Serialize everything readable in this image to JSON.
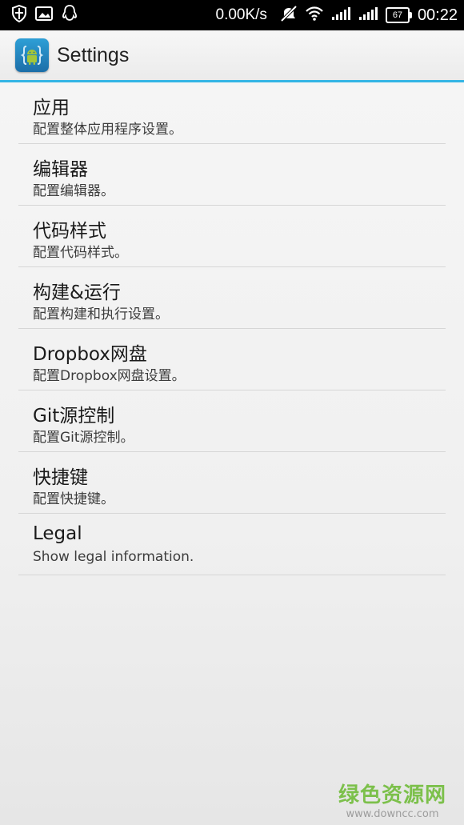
{
  "status_bar": {
    "net_speed": "0.00K/s",
    "battery": "67",
    "time": "00:22",
    "icons": [
      "shield-icon",
      "image-icon",
      "qq-icon",
      "mute-icon",
      "wifi-icon",
      "signal-icon",
      "signal-icon"
    ]
  },
  "action_bar": {
    "title": "Settings",
    "accent_color": "#33b5e5"
  },
  "settings": {
    "items": [
      {
        "title": "应用",
        "subtitle": "配置整体应用程序设置。"
      },
      {
        "title": "编辑器",
        "subtitle": "配置编辑器。"
      },
      {
        "title": "代码样式",
        "subtitle": "配置代码样式。"
      },
      {
        "title": "构建&运行",
        "subtitle": "配置构建和执行设置。"
      },
      {
        "title": "Dropbox网盘",
        "subtitle": "配置Dropbox网盘设置。"
      },
      {
        "title": "Git源控制",
        "subtitle": "配置Git源控制。"
      },
      {
        "title": "快捷键",
        "subtitle": "配置快捷键。"
      },
      {
        "title": "Legal",
        "subtitle": "Show legal information."
      }
    ]
  },
  "watermark": {
    "main": "绿色资源网",
    "url": "www.downcc.com"
  }
}
